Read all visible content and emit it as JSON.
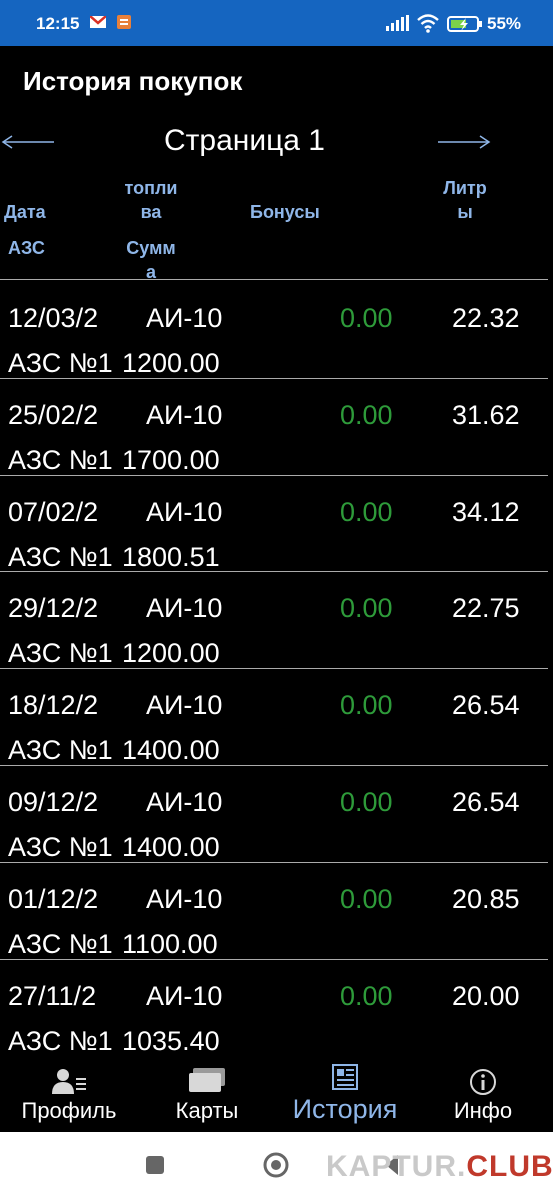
{
  "status_bar": {
    "time": "12:15",
    "battery_text": "55%",
    "icons": [
      "gmail-icon",
      "notification-icon",
      "signal-icon",
      "wifi-icon",
      "battery-charging-icon"
    ]
  },
  "header": {
    "title": "История покупок"
  },
  "pager": {
    "label": "Страница 1",
    "prev_icon": "arrow-left-icon",
    "next_icon": "arrow-right-icon"
  },
  "table": {
    "headers": {
      "date": "Дата",
      "fuel_line1": "топли",
      "fuel_line2": "ва",
      "bonus": "Бонусы",
      "liters_line1": "Литр",
      "liters_line2": "ы",
      "station": "АЗС",
      "sum_line1": "Сумм",
      "sum_line2": "а"
    },
    "rows": [
      {
        "date": "12/03/2",
        "fuel": "АИ-10",
        "bonus": "0.00",
        "liters": "22.32",
        "station": "АЗС №1",
        "sum": "1200.00"
      },
      {
        "date": "25/02/2",
        "fuel": "АИ-10",
        "bonus": "0.00",
        "liters": "31.62",
        "station": "АЗС №1",
        "sum": "1700.00"
      },
      {
        "date": "07/02/2",
        "fuel": "АИ-10",
        "bonus": "0.00",
        "liters": "34.12",
        "station": "АЗС №1",
        "sum": "1800.51"
      },
      {
        "date": "29/12/2",
        "fuel": "АИ-10",
        "bonus": "0.00",
        "liters": "22.75",
        "station": "АЗС №1",
        "sum": "1200.00"
      },
      {
        "date": "18/12/2",
        "fuel": "АИ-10",
        "bonus": "0.00",
        "liters": "26.54",
        "station": "АЗС №1",
        "sum": "1400.00"
      },
      {
        "date": "09/12/2",
        "fuel": "АИ-10",
        "bonus": "0.00",
        "liters": "26.54",
        "station": "АЗС №1",
        "sum": "1400.00"
      },
      {
        "date": "01/12/2",
        "fuel": "АИ-10",
        "bonus": "0.00",
        "liters": "20.85",
        "station": "АЗС №1",
        "sum": "1100.00"
      },
      {
        "date": "27/11/2",
        "fuel": "АИ-10",
        "bonus": "0.00",
        "liters": "20.00",
        "station": "АЗС №1",
        "sum": "1035.40"
      }
    ]
  },
  "bottom_nav": {
    "active": "history",
    "items": [
      {
        "id": "profile",
        "label": "Профиль",
        "icon": "profile-icon"
      },
      {
        "id": "cards",
        "label": "Карты",
        "icon": "cards-icon"
      },
      {
        "id": "history",
        "label": "История",
        "icon": "history-icon"
      },
      {
        "id": "info",
        "label": "Инфо",
        "icon": "info-icon"
      }
    ]
  },
  "watermark": {
    "main": "KAPTUR.",
    "club": "CLUB"
  },
  "colors": {
    "status_bar": "#1565c0",
    "header_text": "#8fb6e8",
    "bonus_green": "#2e9b3a",
    "active_tab": "#8fb6e8",
    "watermark_red": "#c0392b"
  }
}
